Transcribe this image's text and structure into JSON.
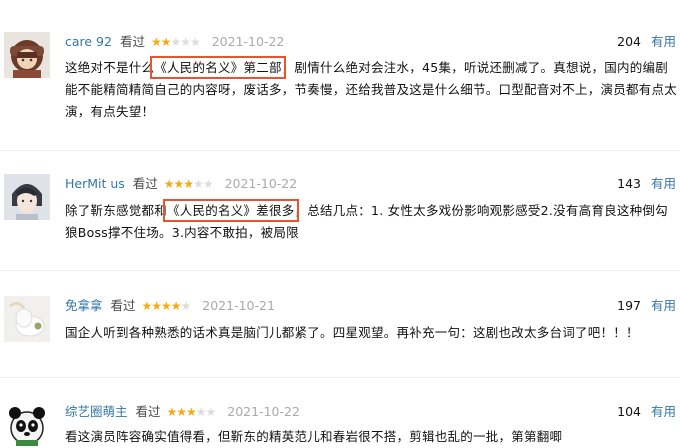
{
  "reviews": [
    {
      "user": "care 92",
      "watched": "看过",
      "stars": 2,
      "date": "2021-10-22",
      "useful_count": "204",
      "useful_label": "有用",
      "text_before": "这绝对不是什么",
      "text_highlight": "《人民的名义》第二部",
      "text_after": "，剧情什么绝对会注水，45集，听说还删减了。真想说，国内的编剧能不能精简精简自己的内容呀，废话多，节奏慢，还给我普及这是什么细节。口型配音对不上，演员都有点太演，有点失望！"
    },
    {
      "user": "HerMit us",
      "watched": "看过",
      "stars": 3,
      "date": "2021-10-22",
      "useful_count": "143",
      "useful_label": "有用",
      "text_before": "除了靳东感觉都和",
      "text_highlight": "《人民的名义》差很多",
      "text_after": "，总结几点：1. 女性太多戏份影响观影感受2.没有高育良这种倒勾狼Boss撑不住场。3.内容不敢拍，被局限"
    },
    {
      "user": "免拿拿",
      "watched": "看过",
      "stars": 4,
      "date": "2021-10-21",
      "useful_count": "197",
      "useful_label": "有用",
      "text": "国企人听到各种熟悉的话术真是脑门儿都紧了。四星观望。再补充一句：这剧也改太多台词了吧！！！"
    },
    {
      "user": "综艺圈萌主",
      "watched": "看过",
      "stars": 3,
      "date": "2021-10-22",
      "useful_count": "104",
      "useful_label": "有用",
      "text": "看这演员阵容确实值得看，但靳东的精英范儿和春岩很不搭，剪辑也乱的一批，第第翻唧"
    }
  ],
  "colors": {
    "link": "#3377aa",
    "star": "#f4aa19",
    "highlight": "#e8542e"
  }
}
